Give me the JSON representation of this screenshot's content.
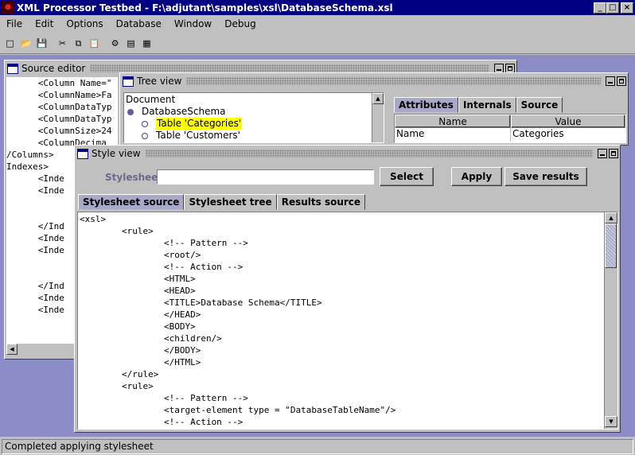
{
  "window": {
    "title": "XML Processor Testbed - F:\\adjutant\\samples\\xsl\\DatabaseSchema.xsl",
    "min_glyph": "_",
    "max_glyph": "□",
    "close_glyph": "×"
  },
  "menu": [
    "File",
    "Edit",
    "Options",
    "Database",
    "Window",
    "Debug"
  ],
  "toolbar": {
    "icons": [
      "new-file-icon",
      "open-folder-icon",
      "save-disk-icon",
      "cut-scissors-icon",
      "copy-icon",
      "paste-icon",
      "run-processor-icon",
      "document-icon",
      "document-alt-icon"
    ],
    "glyphs": [
      "□",
      "📂",
      "💾",
      "✂",
      "⧉",
      "📋",
      "⚙",
      "▤",
      "▦"
    ]
  },
  "source_editor": {
    "title": "Source editor",
    "lines": [
      "      <Column Name=\"",
      "      <ColumnName>Fa",
      "      <ColumnDataTyp",
      "      <ColumnDataTyp",
      "      <ColumnSize>24",
      "      <ColumnDecima",
      "/Columns>",
      "Indexes>",
      "      <Inde",
      "      <Inde",
      "",
      "",
      "      </Ind",
      "      <Inde",
      "      <Inde",
      "",
      "",
      "      </Ind",
      "      <Inde",
      "      <Inde"
    ]
  },
  "tree_view": {
    "title": "Tree view",
    "nodes": [
      {
        "label": "Document",
        "level": 0,
        "selected": false
      },
      {
        "label": "DatabaseSchema",
        "level": 1,
        "selected": false
      },
      {
        "label": "Table 'Categories'",
        "level": 2,
        "selected": true
      },
      {
        "label": "Table 'Customers'",
        "level": 2,
        "selected": false
      }
    ],
    "tabs": [
      "Attributes",
      "Internals",
      "Source"
    ],
    "active_tab": 0,
    "table": {
      "headers": [
        "Name",
        "Value"
      ],
      "rows": [
        [
          "Name",
          "Categories"
        ]
      ]
    }
  },
  "style_view": {
    "title": "Style view",
    "stylesheet_label": "Stylesheet",
    "stylesheet_value": "",
    "buttons": {
      "select": "Select",
      "apply": "Apply",
      "save": "Save results"
    },
    "tabs": [
      "Stylesheet source",
      "Stylesheet tree",
      "Results source"
    ],
    "active_tab": 0,
    "source_lines": [
      "<xsl>",
      "        <rule>",
      "                <!-- Pattern -->",
      "                <root/>",
      "                <!-- Action -->",
      "                <HTML>",
      "                <HEAD>",
      "                <TITLE>Database Schema</TITLE>",
      "                </HEAD>",
      "                <BODY>",
      "                <children/>",
      "                </BODY>",
      "                </HTML>",
      "        </rule>",
      "        <rule>",
      "                <!-- Pattern -->",
      "                <target-element type = \"DatabaseTableName\"/>",
      "                <!-- Action -->"
    ]
  },
  "status": "Completed applying stylesheet",
  "colors": {
    "title_bar": "#000080",
    "desktop": "#8c8cc8",
    "selection": "#ffff00",
    "active_tab": "#a8a8c8"
  }
}
